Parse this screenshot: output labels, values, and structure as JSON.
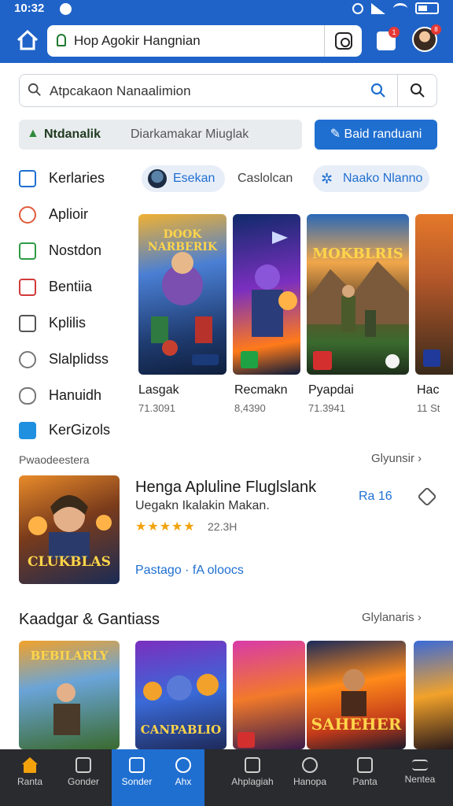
{
  "status": {
    "time": "10:32"
  },
  "browser": {
    "url": "Hop Agokir Hangnian",
    "tabs_count": "1",
    "avatar_badge": "8"
  },
  "search": {
    "placeholder": "Atpcakaon Nanaalimion"
  },
  "filter": {
    "strong": "Ntdanalik",
    "sub": "Diarkamakar Miuglak",
    "button": "Baid randuani"
  },
  "sidebar": {
    "items": [
      {
        "label": "Kerlaries",
        "icon": "bag-icon"
      },
      {
        "label": "Aplioir",
        "icon": "user-icon"
      },
      {
        "label": "Nostdon",
        "icon": "download-icon"
      },
      {
        "label": "Bentiia",
        "icon": "image-icon"
      },
      {
        "label": "Kplilis",
        "icon": "edit-icon"
      },
      {
        "label": "Slalplidss",
        "icon": "search-icon"
      },
      {
        "label": "Hanuidh",
        "icon": "link-icon"
      },
      {
        "label": "KerGizols",
        "icon": "book-icon"
      }
    ]
  },
  "tabs": [
    {
      "label": "Esekan"
    },
    {
      "label": "Caslolcan"
    },
    {
      "label": "Naako Nlanno"
    }
  ],
  "top_games": [
    {
      "title": "Lasgak",
      "meta": "71.3091"
    },
    {
      "title": "Recmakn",
      "meta": "8,4390"
    },
    {
      "title": "Pyapdai",
      "meta": "71.3941"
    },
    {
      "title": "Hac",
      "meta": "11 St"
    }
  ],
  "section1": {
    "label": "Pwaodeestera",
    "link": "Glyunsir"
  },
  "featured": {
    "title": "Henga Apluline Fluglslank",
    "subtitle": "Uegakn Ikalakin Makan.",
    "rating_value": "22.3H",
    "stars": "★★★★★",
    "link": "Pastago · fA oloocs",
    "score": "Ra 16",
    "poster_text": "CLUKBLAS"
  },
  "section2": {
    "title": "Kaadgar & Gantiass",
    "link": "Glylanaris"
  },
  "bottom_nav": [
    {
      "label": "Ranta"
    },
    {
      "label": "Gonder"
    },
    {
      "label": "Sonder"
    },
    {
      "label": "Ahx"
    },
    {
      "label": "Ahplagiah"
    },
    {
      "label": "Hanopa"
    },
    {
      "label": "Panta"
    },
    {
      "label": "Nentea"
    }
  ],
  "posters_top": [
    "DOOK NARBERIK",
    "",
    "MOKBLRIS",
    ""
  ],
  "posters_bottom": [
    "BEBILARLY",
    "CANPABLIO",
    "",
    "SAHEHER",
    ""
  ],
  "colors": {
    "brand": "#1f63c8",
    "accent": "#1f6fd1",
    "star": "#f2a20c",
    "nav_bg": "#2a2b2e"
  }
}
